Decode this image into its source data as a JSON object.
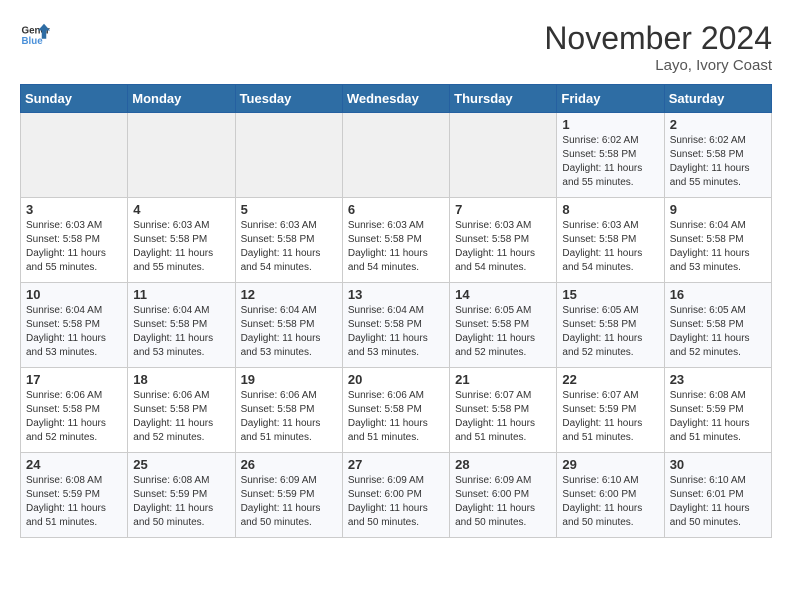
{
  "header": {
    "logo_line1": "General",
    "logo_line2": "Blue",
    "month": "November 2024",
    "location": "Layo, Ivory Coast"
  },
  "days_of_week": [
    "Sunday",
    "Monday",
    "Tuesday",
    "Wednesday",
    "Thursday",
    "Friday",
    "Saturday"
  ],
  "weeks": [
    [
      {
        "day": "",
        "info": ""
      },
      {
        "day": "",
        "info": ""
      },
      {
        "day": "",
        "info": ""
      },
      {
        "day": "",
        "info": ""
      },
      {
        "day": "",
        "info": ""
      },
      {
        "day": "1",
        "info": "Sunrise: 6:02 AM\nSunset: 5:58 PM\nDaylight: 11 hours\nand 55 minutes."
      },
      {
        "day": "2",
        "info": "Sunrise: 6:02 AM\nSunset: 5:58 PM\nDaylight: 11 hours\nand 55 minutes."
      }
    ],
    [
      {
        "day": "3",
        "info": "Sunrise: 6:03 AM\nSunset: 5:58 PM\nDaylight: 11 hours\nand 55 minutes."
      },
      {
        "day": "4",
        "info": "Sunrise: 6:03 AM\nSunset: 5:58 PM\nDaylight: 11 hours\nand 55 minutes."
      },
      {
        "day": "5",
        "info": "Sunrise: 6:03 AM\nSunset: 5:58 PM\nDaylight: 11 hours\nand 54 minutes."
      },
      {
        "day": "6",
        "info": "Sunrise: 6:03 AM\nSunset: 5:58 PM\nDaylight: 11 hours\nand 54 minutes."
      },
      {
        "day": "7",
        "info": "Sunrise: 6:03 AM\nSunset: 5:58 PM\nDaylight: 11 hours\nand 54 minutes."
      },
      {
        "day": "8",
        "info": "Sunrise: 6:03 AM\nSunset: 5:58 PM\nDaylight: 11 hours\nand 54 minutes."
      },
      {
        "day": "9",
        "info": "Sunrise: 6:04 AM\nSunset: 5:58 PM\nDaylight: 11 hours\nand 53 minutes."
      }
    ],
    [
      {
        "day": "10",
        "info": "Sunrise: 6:04 AM\nSunset: 5:58 PM\nDaylight: 11 hours\nand 53 minutes."
      },
      {
        "day": "11",
        "info": "Sunrise: 6:04 AM\nSunset: 5:58 PM\nDaylight: 11 hours\nand 53 minutes."
      },
      {
        "day": "12",
        "info": "Sunrise: 6:04 AM\nSunset: 5:58 PM\nDaylight: 11 hours\nand 53 minutes."
      },
      {
        "day": "13",
        "info": "Sunrise: 6:04 AM\nSunset: 5:58 PM\nDaylight: 11 hours\nand 53 minutes."
      },
      {
        "day": "14",
        "info": "Sunrise: 6:05 AM\nSunset: 5:58 PM\nDaylight: 11 hours\nand 52 minutes."
      },
      {
        "day": "15",
        "info": "Sunrise: 6:05 AM\nSunset: 5:58 PM\nDaylight: 11 hours\nand 52 minutes."
      },
      {
        "day": "16",
        "info": "Sunrise: 6:05 AM\nSunset: 5:58 PM\nDaylight: 11 hours\nand 52 minutes."
      }
    ],
    [
      {
        "day": "17",
        "info": "Sunrise: 6:06 AM\nSunset: 5:58 PM\nDaylight: 11 hours\nand 52 minutes."
      },
      {
        "day": "18",
        "info": "Sunrise: 6:06 AM\nSunset: 5:58 PM\nDaylight: 11 hours\nand 52 minutes."
      },
      {
        "day": "19",
        "info": "Sunrise: 6:06 AM\nSunset: 5:58 PM\nDaylight: 11 hours\nand 51 minutes."
      },
      {
        "day": "20",
        "info": "Sunrise: 6:06 AM\nSunset: 5:58 PM\nDaylight: 11 hours\nand 51 minutes."
      },
      {
        "day": "21",
        "info": "Sunrise: 6:07 AM\nSunset: 5:58 PM\nDaylight: 11 hours\nand 51 minutes."
      },
      {
        "day": "22",
        "info": "Sunrise: 6:07 AM\nSunset: 5:59 PM\nDaylight: 11 hours\nand 51 minutes."
      },
      {
        "day": "23",
        "info": "Sunrise: 6:08 AM\nSunset: 5:59 PM\nDaylight: 11 hours\nand 51 minutes."
      }
    ],
    [
      {
        "day": "24",
        "info": "Sunrise: 6:08 AM\nSunset: 5:59 PM\nDaylight: 11 hours\nand 51 minutes."
      },
      {
        "day": "25",
        "info": "Sunrise: 6:08 AM\nSunset: 5:59 PM\nDaylight: 11 hours\nand 50 minutes."
      },
      {
        "day": "26",
        "info": "Sunrise: 6:09 AM\nSunset: 5:59 PM\nDaylight: 11 hours\nand 50 minutes."
      },
      {
        "day": "27",
        "info": "Sunrise: 6:09 AM\nSunset: 6:00 PM\nDaylight: 11 hours\nand 50 minutes."
      },
      {
        "day": "28",
        "info": "Sunrise: 6:09 AM\nSunset: 6:00 PM\nDaylight: 11 hours\nand 50 minutes."
      },
      {
        "day": "29",
        "info": "Sunrise: 6:10 AM\nSunset: 6:00 PM\nDaylight: 11 hours\nand 50 minutes."
      },
      {
        "day": "30",
        "info": "Sunrise: 6:10 AM\nSunset: 6:01 PM\nDaylight: 11 hours\nand 50 minutes."
      }
    ]
  ]
}
